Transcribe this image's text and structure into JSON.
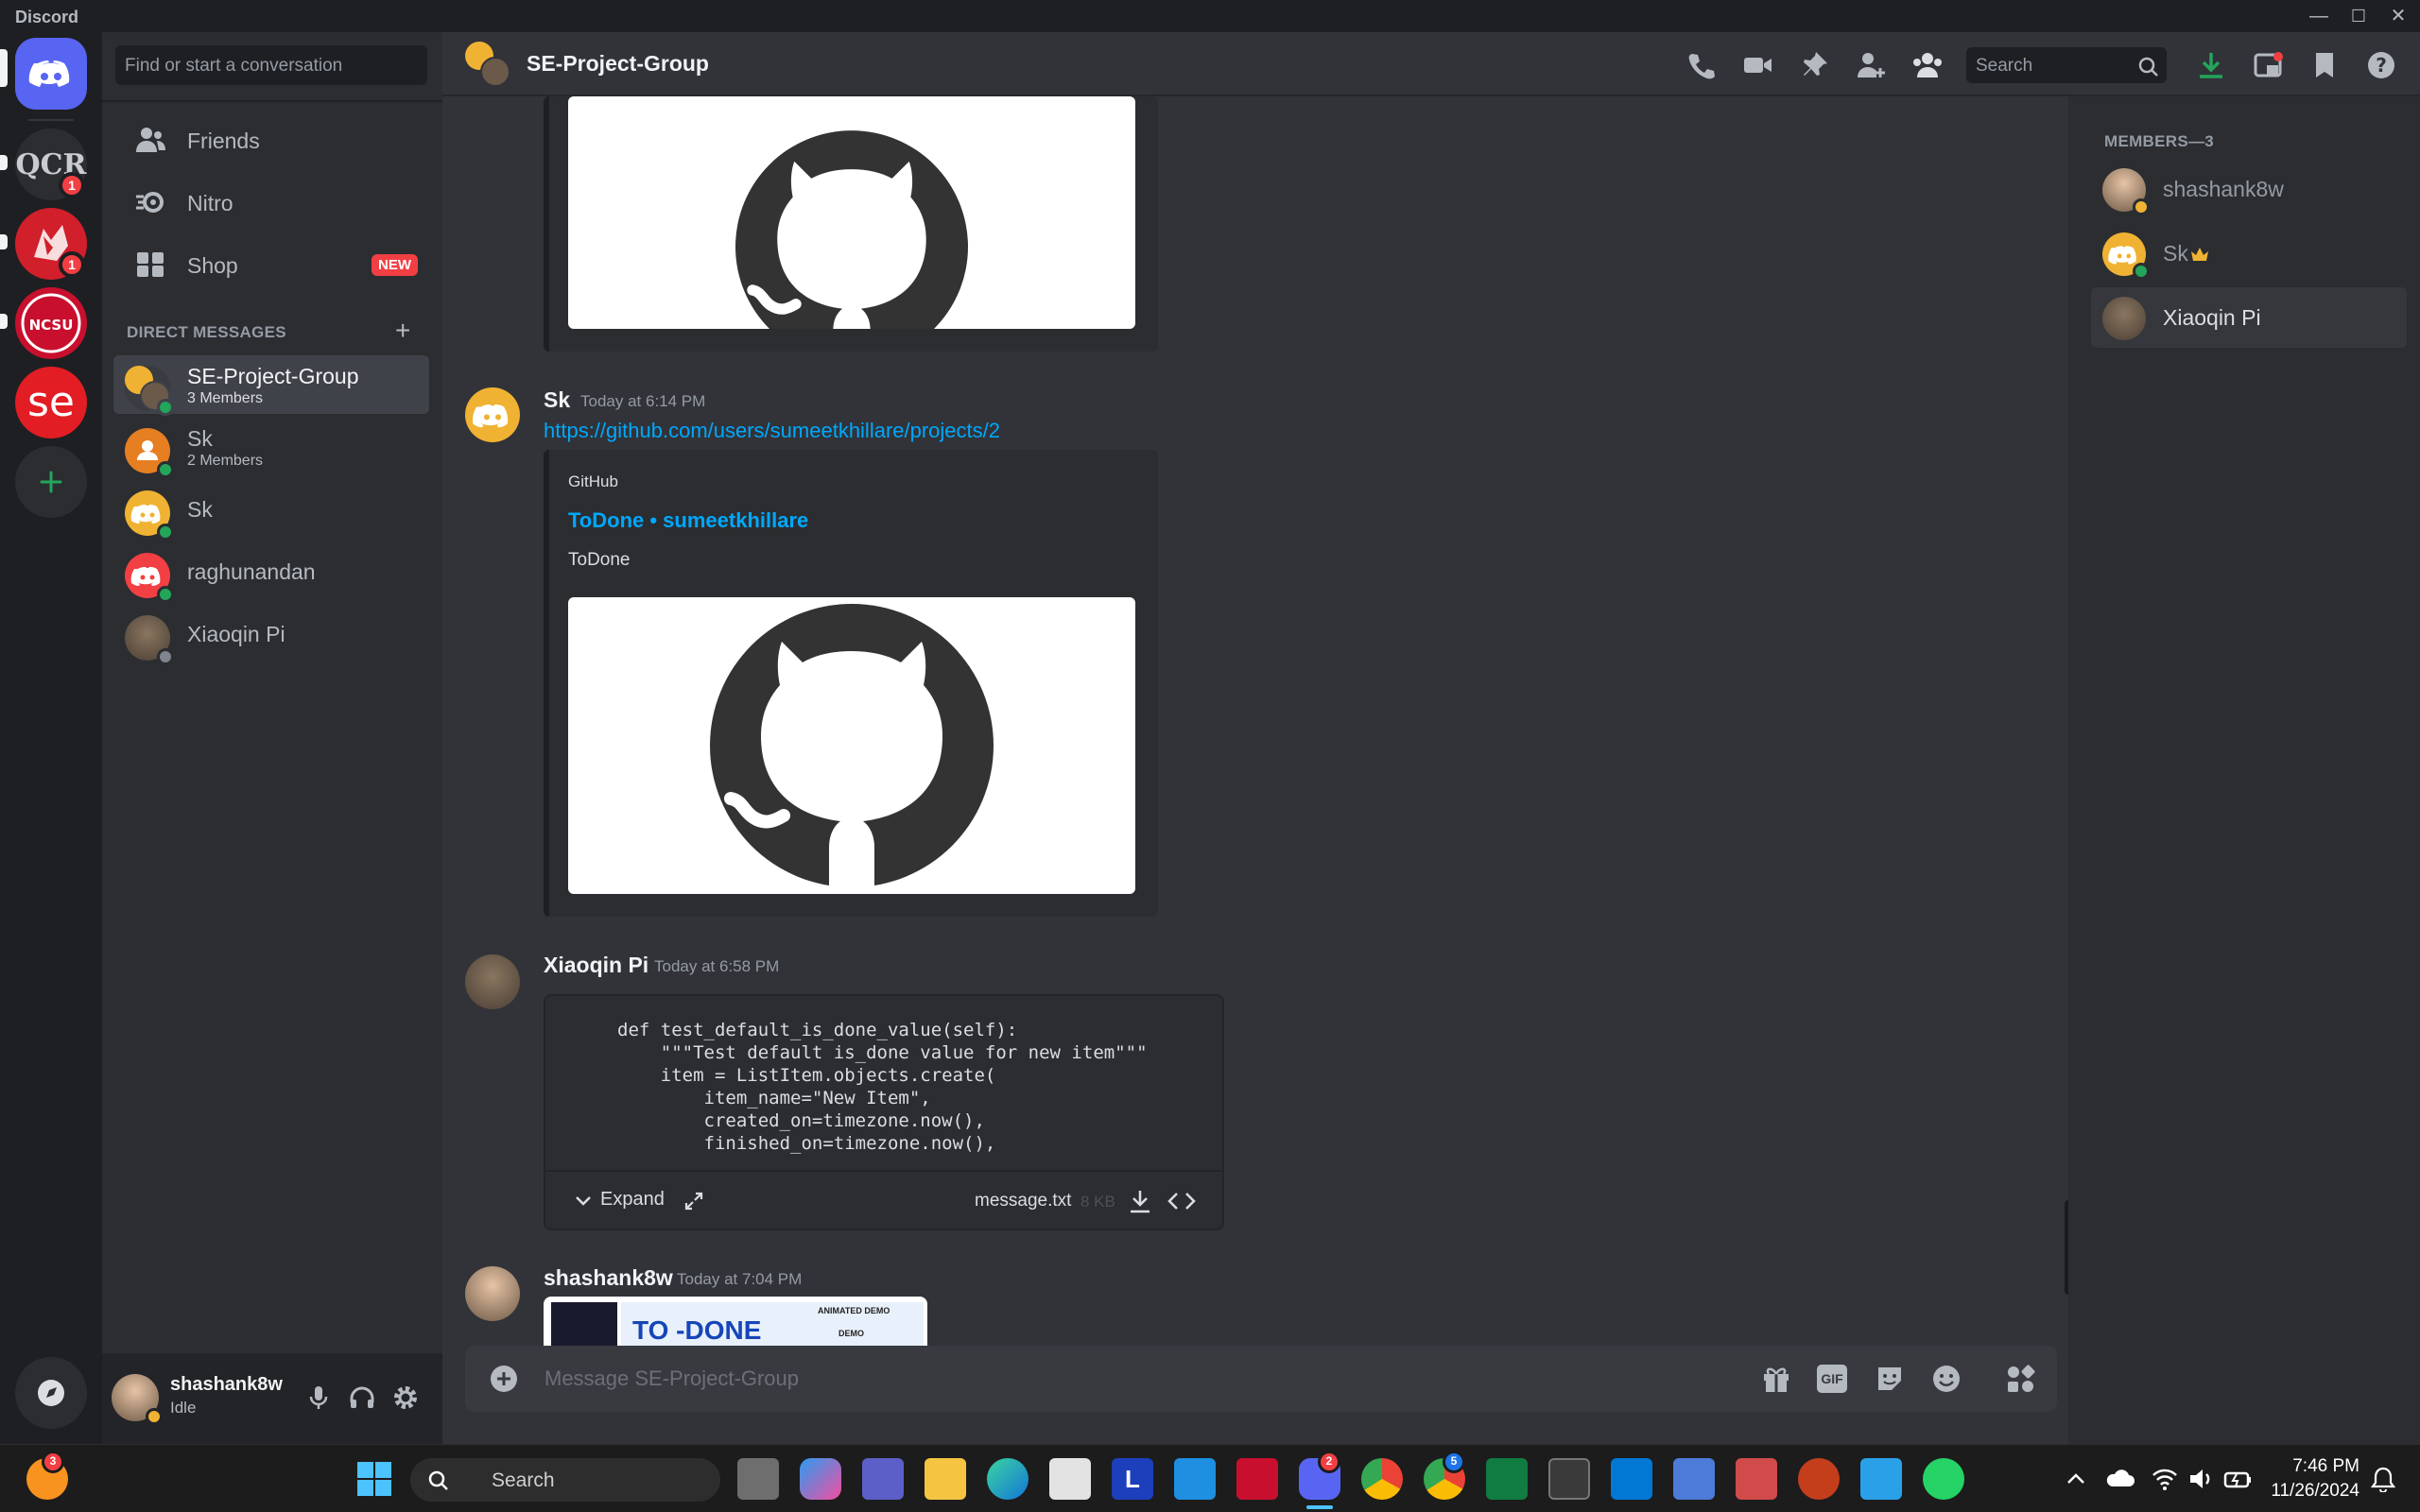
{
  "window": {
    "app_name": "Discord",
    "minimize": "—",
    "maximize": "☐",
    "close": "✕"
  },
  "servers": [
    {
      "name": "QCR",
      "badge": "1"
    },
    {
      "name": "red-server",
      "badge": "1"
    },
    {
      "name": "NCSU",
      "badge": ""
    },
    {
      "name": "se",
      "badge": ""
    }
  ],
  "sidebar": {
    "search_placeholder": "Find or start a conversation",
    "nav": [
      {
        "label": "Friends"
      },
      {
        "label": "Nitro"
      },
      {
        "label": "Shop",
        "badge": "NEW"
      }
    ],
    "dm_header": "DIRECT MESSAGES",
    "dms": [
      {
        "name": "SE-Project-Group",
        "sub": "3 Members"
      },
      {
        "name": "Sk",
        "sub": "2 Members"
      },
      {
        "name": "Sk",
        "sub": ""
      },
      {
        "name": "raghunandan",
        "sub": ""
      },
      {
        "name": "Xiaoqin Pi",
        "sub": ""
      }
    ]
  },
  "user": {
    "name": "shashank8w",
    "status": "Idle"
  },
  "header": {
    "title": "SE-Project-Group",
    "search_placeholder": "Search"
  },
  "members": {
    "header": "MEMBERS—3",
    "list": [
      {
        "name": "shashank8w"
      },
      {
        "name": "Sk"
      },
      {
        "name": "Xiaoqin Pi"
      }
    ]
  },
  "messages": {
    "m1": {
      "author": "Sk",
      "time": "Today at 6:14 PM",
      "link": "https://github.com/users/sumeetkhillare/projects/2",
      "embed": {
        "provider": "GitHub",
        "title": "ToDone • sumeetkhillare",
        "description": "ToDone"
      }
    },
    "m2": {
      "author": "Xiaoqin Pi",
      "time": "Today at 6:58 PM",
      "code": "def test_default_is_done_value(self):\n    \"\"\"Test default is_done value for new item\"\"\"\n    item = ListItem.objects.create(\n        item_name=\"New Item\",\n        created_on=timezone.now(),\n        finished_on=timezone.now(),",
      "expand": "Expand",
      "filename": "message.txt",
      "filesize": "8 KB"
    },
    "m3": {
      "author": "shashank8w",
      "time": "Today at 7:04 PM",
      "preview_title": "TO -DONE",
      "preview_demo1": "ANIMATED DEMO",
      "preview_demo2": "DEMO"
    }
  },
  "composer": {
    "placeholder": "Message SE-Project-Group",
    "gif": "GIF"
  },
  "taskbar": {
    "search": "Search",
    "time": "7:46 PM",
    "date": "11/26/2024",
    "discord_badge": "2",
    "chrome_badge": "5",
    "left_badge": "3"
  },
  "colors": {
    "blurple": "#5865f2",
    "link": "#00a8fc",
    "online": "#23a55a",
    "idle": "#f0b232",
    "danger": "#f23f43"
  }
}
